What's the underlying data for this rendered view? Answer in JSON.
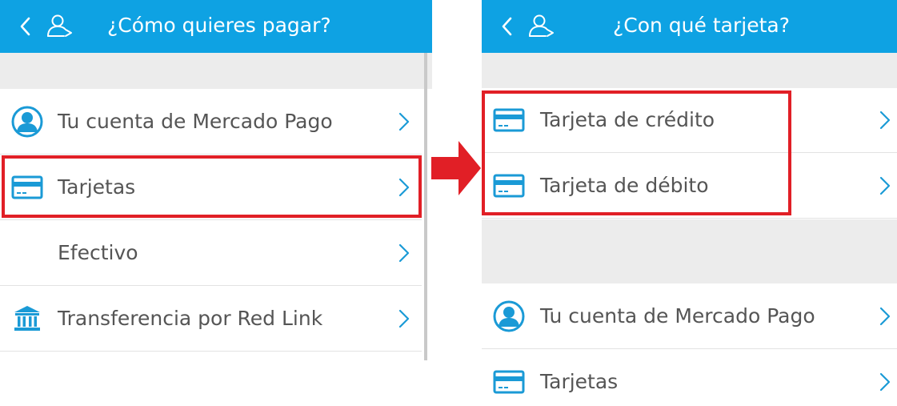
{
  "colors": {
    "header": "#0ea2e3",
    "icon": "#1a9ad6",
    "text": "#555555",
    "highlight": "#e11f26"
  },
  "left_screen": {
    "title": "¿Cómo quieres pagar?",
    "items": [
      {
        "label": "Tu cuenta de Mercado Pago",
        "icon": "account-circle-icon"
      },
      {
        "label": "Tarjetas",
        "icon": "card-icon",
        "highlighted": true
      },
      {
        "label": "Efectivo",
        "icon": ""
      },
      {
        "label": "Transferencia por Red Link",
        "icon": "bank-icon"
      }
    ]
  },
  "right_screen": {
    "title": "¿Con qué tarjeta?",
    "items": [
      {
        "label": "Tarjeta de crédito",
        "icon": "card-icon",
        "highlighted": true
      },
      {
        "label": "Tarjeta de débito",
        "icon": "card-icon",
        "highlighted": true
      },
      {
        "label": "Tu cuenta de Mercado Pago",
        "icon": "account-circle-icon"
      },
      {
        "label": "Tarjetas",
        "icon": "card-icon"
      }
    ]
  },
  "annotation_arrow": "red-arrow-icon"
}
